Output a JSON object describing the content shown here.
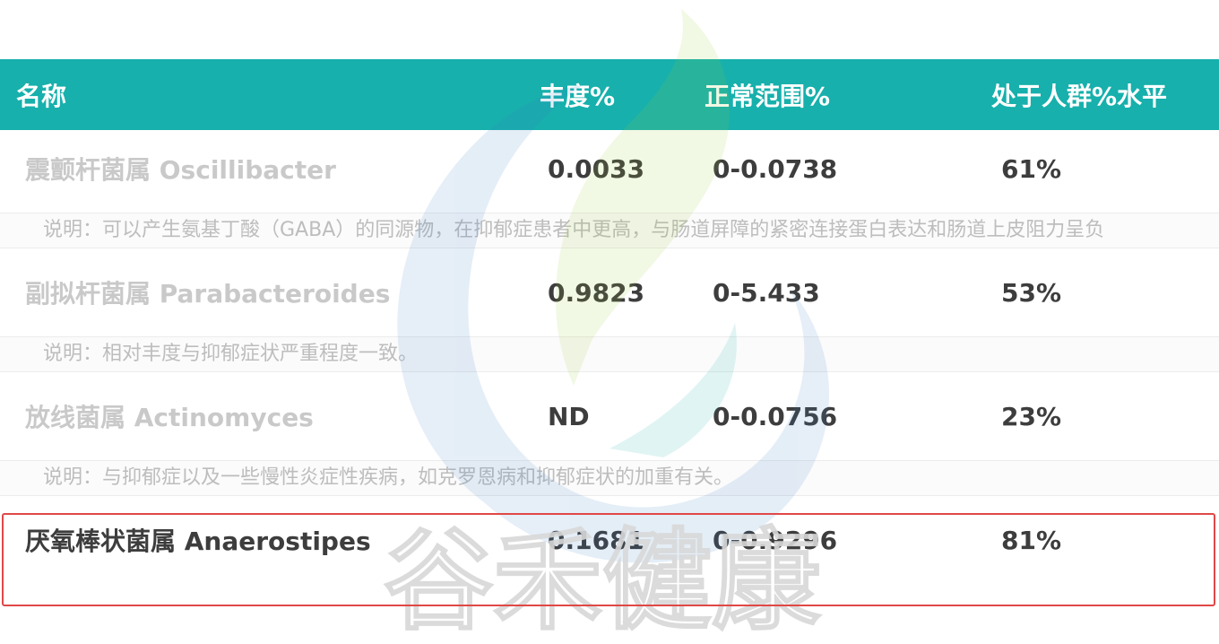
{
  "table": {
    "headers": {
      "name": "名称",
      "abundance": "丰度%",
      "range": "正常范围%",
      "percentile": "处于人群%水平"
    },
    "rows": [
      {
        "name": "震颤杆菌属 Oscillibacter",
        "abundance": "0.0033",
        "range": "0-0.0738",
        "percentile": "61%",
        "note": "说明：可以产生氨基丁酸（GABA）的同源物，在抑郁症患者中更高，与肠道屏障的紧密连接蛋白表达和肠道上皮阻力呈负"
      },
      {
        "name": "副拟杆菌属 Parabacteroides",
        "abundance": "0.9823",
        "range": "0-5.433",
        "percentile": "53%",
        "note": "说明：相对丰度与抑郁症状严重程度一致。"
      },
      {
        "name": "放线菌属 Actinomyces",
        "abundance": "ND",
        "range": "0-0.0756",
        "percentile": "23%",
        "note": "说明：与抑郁症以及一些慢性炎症性疾病，如克罗恩病和抑郁症状的加重有关。"
      },
      {
        "name": "厌氧棒状菌属 Anaerostipes",
        "abundance": "0.1681",
        "range": "0-0.9296",
        "percentile": "81%"
      }
    ]
  },
  "watermark": {
    "text": "谷禾健康",
    "logo": "leaf-swirl-logo"
  },
  "colors": {
    "header_bg": "#17b0ac",
    "highlight_border": "#e04848",
    "text_dark": "#3d3d3d",
    "text_faded": "#c9c9c9",
    "note_text": "#bdbdbd"
  }
}
